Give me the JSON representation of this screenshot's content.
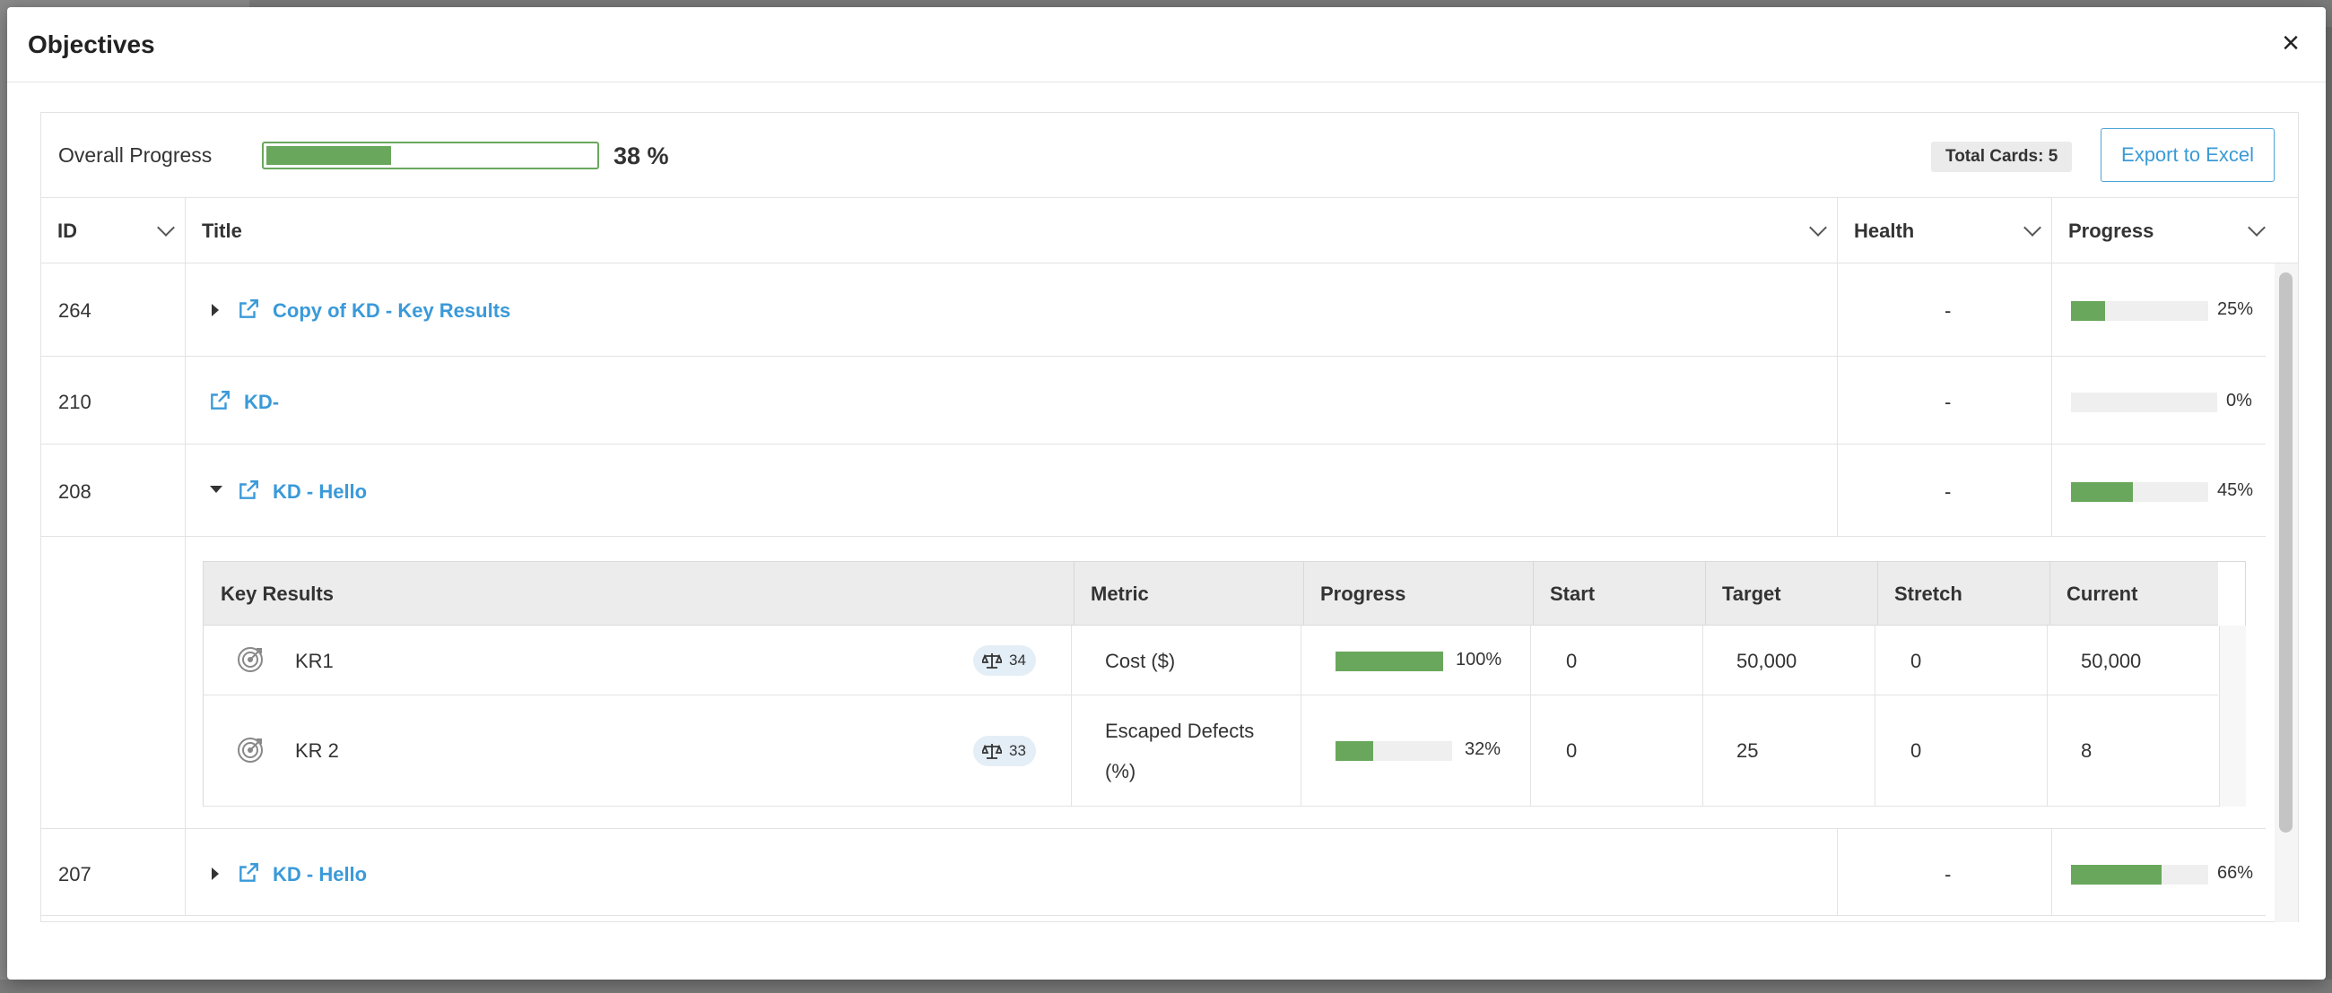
{
  "modal": {
    "title": "Objectives",
    "close_label": "×"
  },
  "overall": {
    "label": "Overall Progress",
    "percent": 38,
    "percent_text": "38 %"
  },
  "total_cards": "Total Cards: 5",
  "export_label": "Export to Excel",
  "columns": {
    "id": "ID",
    "title": "Title",
    "health": "Health",
    "progress": "Progress"
  },
  "rows": [
    {
      "id": "264",
      "title": "Copy of KD - Key Results",
      "health": "-",
      "progress": 25,
      "progress_text": "25%",
      "expanded": false
    },
    {
      "id": "210",
      "title": "KD-",
      "health": "-",
      "progress": 0,
      "progress_text": "0%",
      "expanded": null
    },
    {
      "id": "208",
      "title": "KD - Hello",
      "health": "-",
      "progress": 45,
      "progress_text": "45%",
      "expanded": true
    },
    {
      "id": "207",
      "title": "KD - Hello",
      "health": "-",
      "progress": 66,
      "progress_text": "66%",
      "expanded": false
    }
  ],
  "key_results": {
    "columns": {
      "name": "Key Results",
      "metric": "Metric",
      "progress": "Progress",
      "start": "Start",
      "target": "Target",
      "stretch": "Stretch",
      "current": "Current"
    },
    "items": [
      {
        "name": "KR1",
        "weight": "34",
        "metric": "Cost ($)",
        "progress": 100,
        "progress_text": "100%",
        "start": "0",
        "target": "50,000",
        "stretch": "0",
        "current": "50,000"
      },
      {
        "name": "KR 2",
        "weight": "33",
        "metric_line1": "Escaped Defects",
        "metric_line2": "(%)",
        "progress": 32,
        "progress_text": "32%",
        "start": "0",
        "target": "25",
        "stretch": "0",
        "current": "8"
      }
    ]
  },
  "colors": {
    "accent": "#3a9ad9",
    "progress_fill": "#69a85c",
    "track": "#efefef"
  }
}
